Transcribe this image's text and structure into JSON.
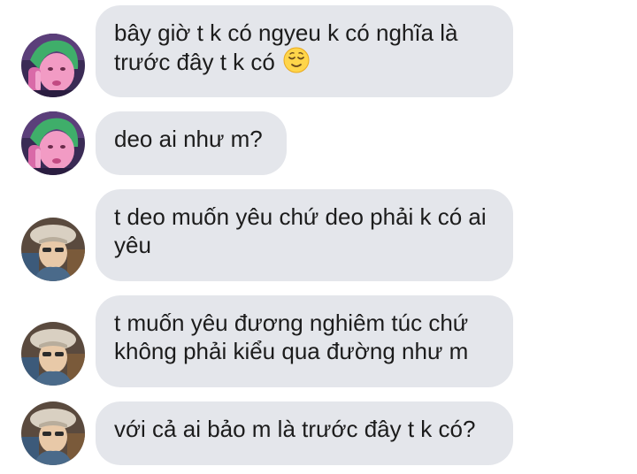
{
  "messages": [
    {
      "sender": "pink-haired",
      "text": "bây giờ t k có ngyeu k có nghĩa là trước đây t k có",
      "emoji": "relieved-face-icon"
    },
    {
      "sender": "pink-haired",
      "text": "deo ai như m?"
    },
    {
      "sender": "beret",
      "text": "t deo muốn yêu chứ deo phải k có ai yêu"
    },
    {
      "sender": "beret",
      "text": "t muốn yêu đương nghiêm túc chứ không phải kiểu qua đường như m"
    },
    {
      "sender": "beret",
      "text": "với cả ai bảo m là trước đây t k có?"
    }
  ],
  "colors": {
    "bubble_bg": "#e4e6eb",
    "text": "#1c1c1c",
    "page_bg": "#ffffff"
  }
}
